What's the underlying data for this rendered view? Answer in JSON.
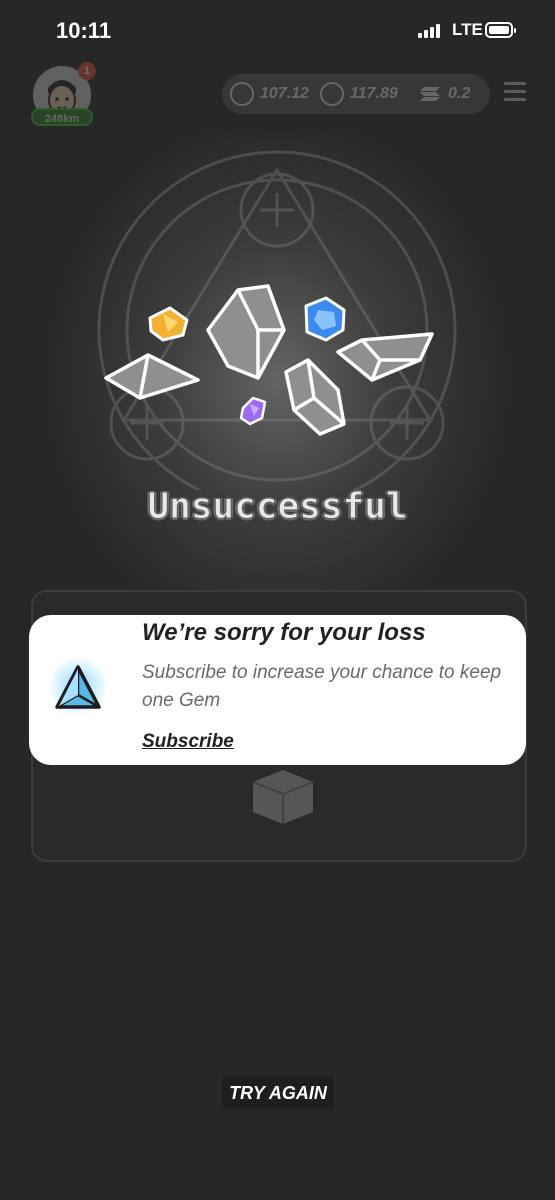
{
  "status_bar": {
    "time": "10:11",
    "network": "LTE"
  },
  "header": {
    "notification_badge": "1",
    "distance": "248km",
    "balances": [
      {
        "icon": "token-a-icon",
        "value": "107.12"
      },
      {
        "icon": "token-g-icon",
        "value": "117.89"
      },
      {
        "icon": "solana-icon",
        "value": "0.2"
      }
    ],
    "menu_icon": "menu-icon"
  },
  "result": {
    "title": "Unsuccessful"
  },
  "toast": {
    "icon": "triangle-gem-icon",
    "title": "We’re sorry for your loss",
    "message": "Subscribe to increase your chance to keep one Gem",
    "link_label": "Subscribe"
  },
  "actions": {
    "try_again_label": "TRY AGAIN"
  },
  "colors": {
    "background": "#282727",
    "toast_background": "#ffffff",
    "badge": "#e5553a"
  }
}
